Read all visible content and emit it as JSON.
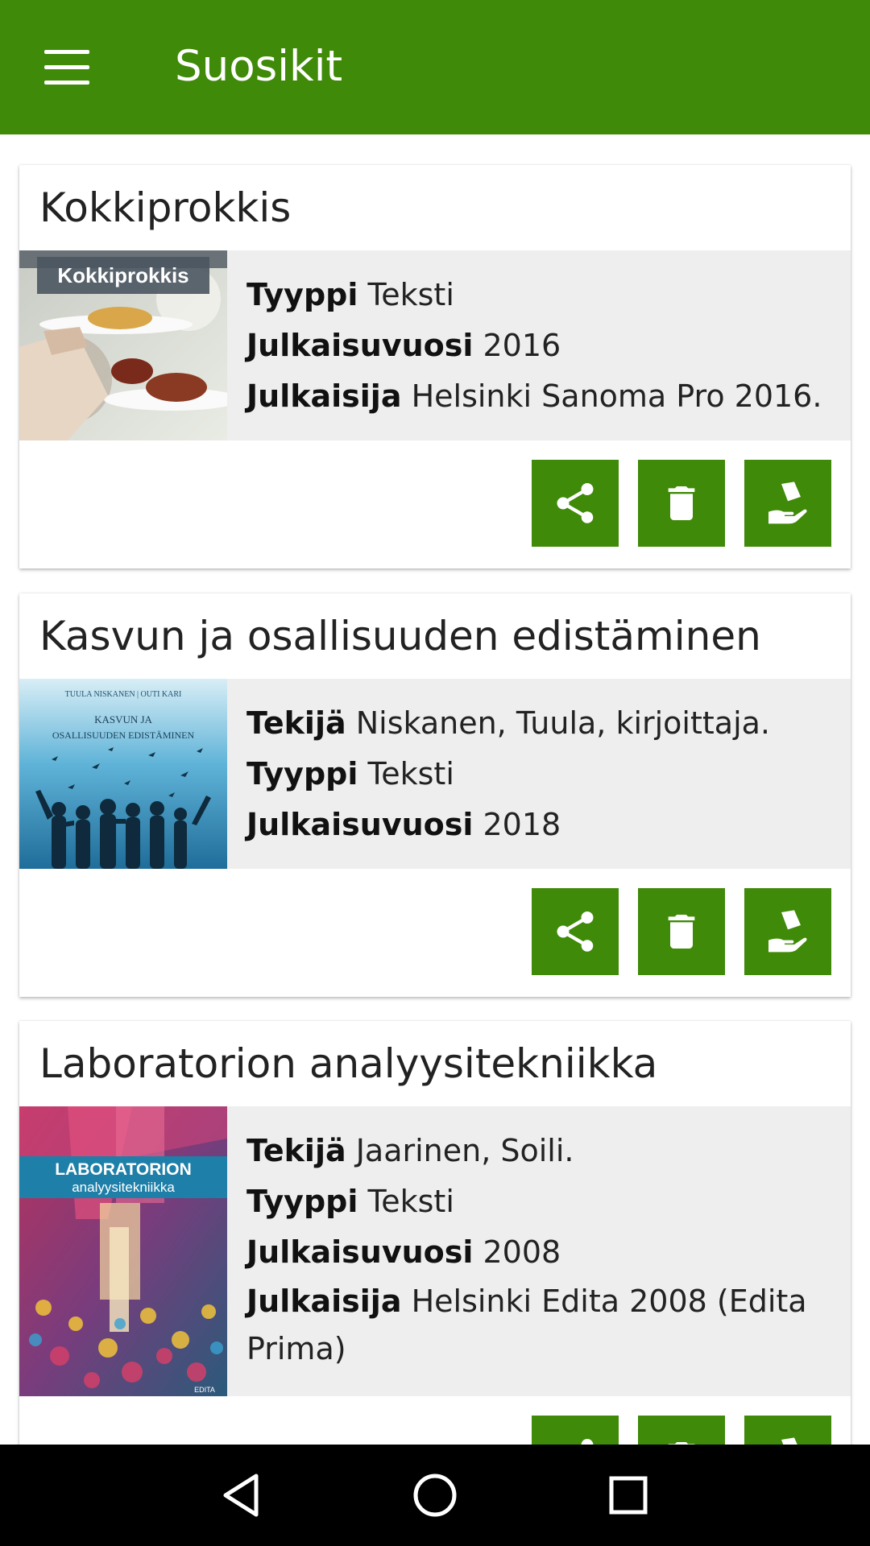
{
  "appbar": {
    "title": "Suosikit",
    "menu_icon": "hamburger-menu-icon"
  },
  "colors": {
    "primary": "#3f8a08",
    "info_bg": "#eeeeee",
    "navbar_bg": "#000000"
  },
  "favorites": [
    {
      "title": "Kokkiprokkis",
      "cover_text": "Kokkiprokkis",
      "fields": [
        {
          "label": "Tyyppi",
          "value": "Teksti"
        },
        {
          "label": "Julkaisuvuosi",
          "value": "2016"
        },
        {
          "label": "Julkaisija",
          "value": "Helsinki Sanoma Pro 2016."
        }
      ],
      "actions": [
        "share-icon",
        "delete-icon",
        "reserve-icon"
      ]
    },
    {
      "title": "Kasvun ja osallisuuden edistäminen",
      "cover_authors": "TUULA NISKANEN | OUTI KARI",
      "cover_text_1": "KASVUN JA",
      "cover_text_2": "OSALLISUUDEN EDISTÄMINEN",
      "fields": [
        {
          "label": "Tekijä",
          "value": "Niskanen, Tuula, kirjoittaja."
        },
        {
          "label": "Tyyppi",
          "value": "Teksti"
        },
        {
          "label": "Julkaisuvuosi",
          "value": "2018"
        }
      ],
      "actions": [
        "share-icon",
        "delete-icon",
        "reserve-icon"
      ]
    },
    {
      "title": "Laboratorion analyysitekniikka",
      "cover_text_1": "LABORATORION",
      "cover_text_2": "analyysitekniikka",
      "cover_publisher": "EDITA",
      "fields": [
        {
          "label": "Tekijä",
          "value": "Jaarinen, Soili."
        },
        {
          "label": "Tyyppi",
          "value": "Teksti"
        },
        {
          "label": "Julkaisuvuosi",
          "value": "2008"
        },
        {
          "label": "Julkaisija",
          "value": "Helsinki Edita 2008 (Edita Prima)"
        }
      ],
      "actions": [
        "share-icon",
        "delete-icon",
        "reserve-icon"
      ]
    }
  ],
  "navbar": {
    "buttons": [
      "back-icon",
      "home-icon",
      "recents-icon"
    ]
  }
}
